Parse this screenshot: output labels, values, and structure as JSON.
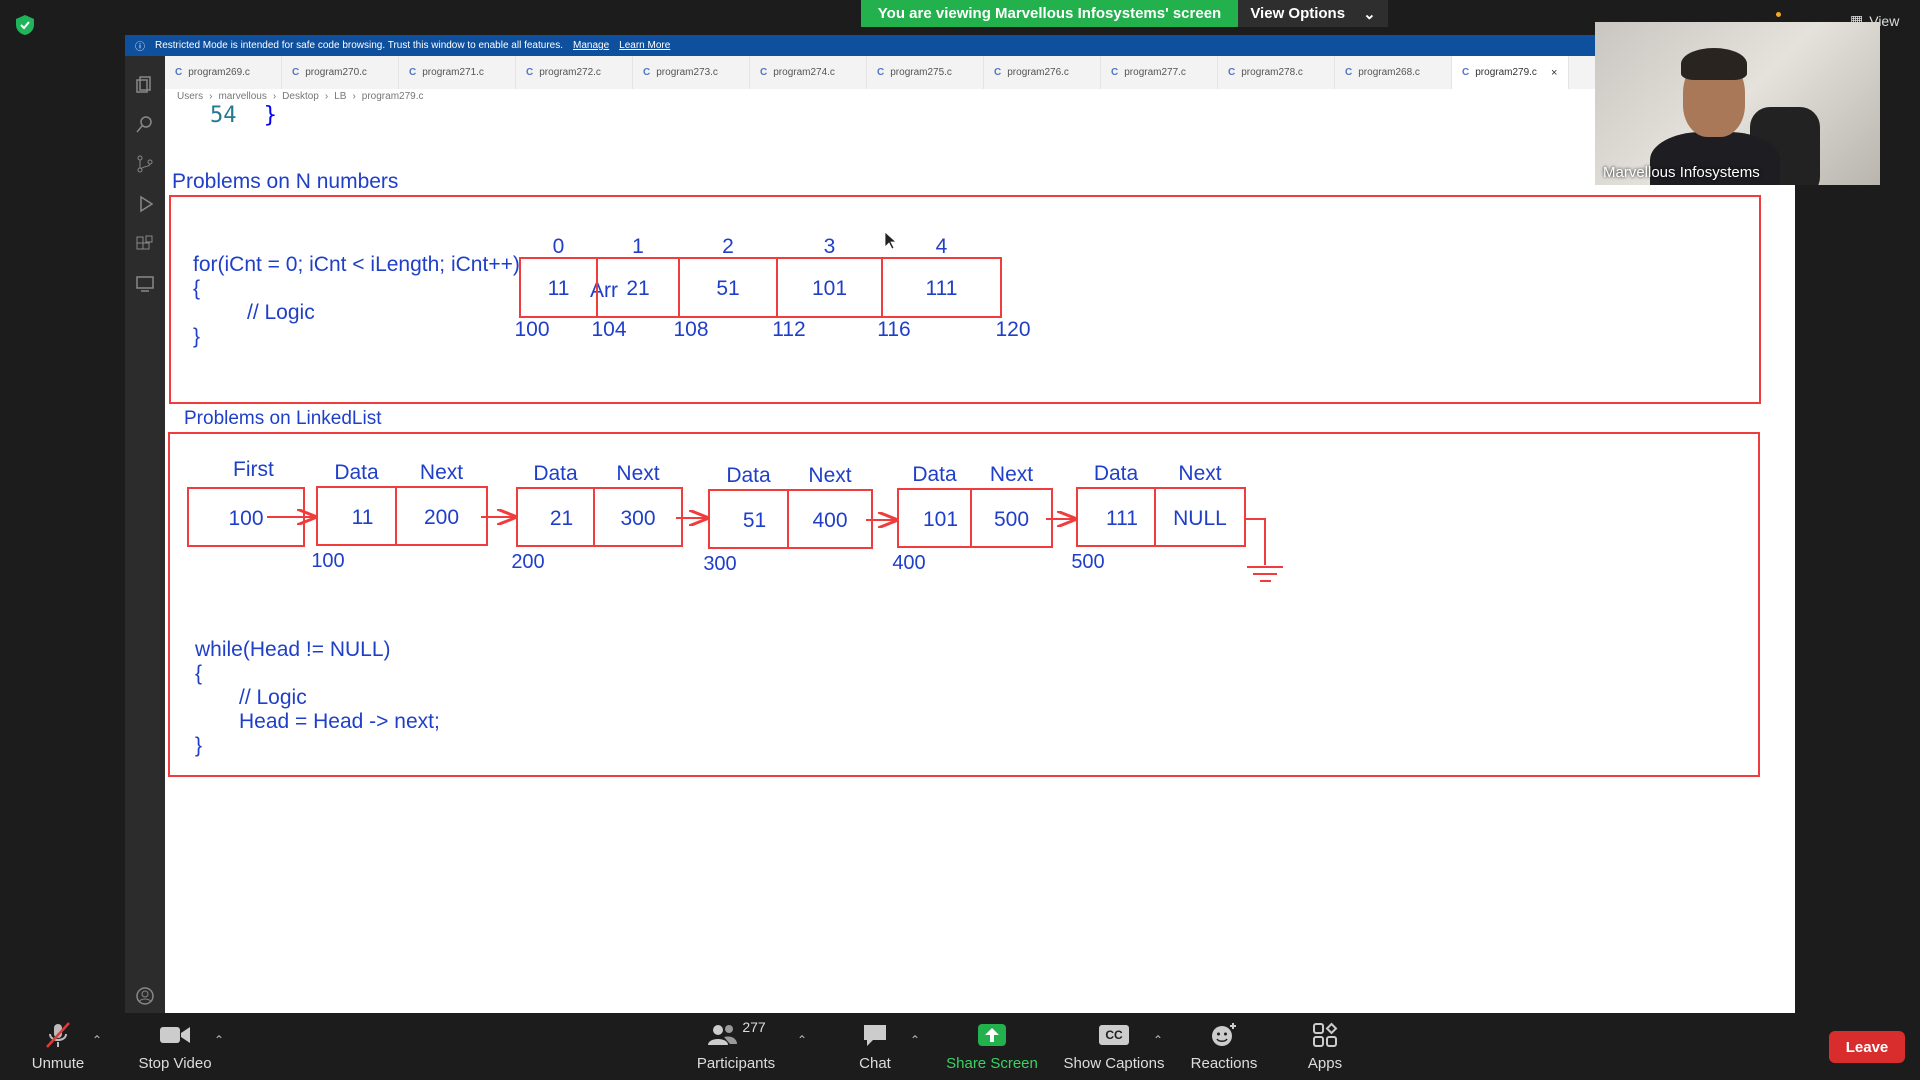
{
  "meeting": {
    "banner_text": "You are viewing Marvellous Infosystems' screen",
    "view_options_label": "View Options",
    "top_view_label": "View"
  },
  "shared_window": {
    "restricted_text": "Restricted Mode is intended for safe code browsing. Trust this window to enable all features.",
    "manage_label": "Manage",
    "learn_more_label": "Learn More",
    "tabs": [
      {
        "label": "program269.c"
      },
      {
        "label": "program270.c"
      },
      {
        "label": "program271.c"
      },
      {
        "label": "program272.c"
      },
      {
        "label": "program273.c"
      },
      {
        "label": "program274.c"
      },
      {
        "label": "program275.c"
      },
      {
        "label": "program276.c"
      },
      {
        "label": "program277.c"
      },
      {
        "label": "program278.c"
      },
      {
        "label": "program268.c"
      },
      {
        "label": "program279.c"
      }
    ],
    "tab_icon_text": "C",
    "breadcrumb": [
      "Users",
      "marvellous",
      "Desktop",
      "LB",
      "program279.c"
    ],
    "code_line_number": "54",
    "code_line_text": "}"
  },
  "whiteboard": {
    "section1_title": "Problems on N numbers",
    "for_code": [
      "for(iCnt = 0; iCnt < iLength; iCnt++)",
      "{",
      "// Logic",
      "}"
    ],
    "array_label": "Arr",
    "array_indices": [
      "0",
      "1",
      "2",
      "3",
      "4"
    ],
    "array_values": [
      "11",
      "21",
      "51",
      "101",
      "111"
    ],
    "array_addresses": [
      "100",
      "104",
      "108",
      "112",
      "116",
      "120"
    ],
    "section2_title": "Problems on LinkedList",
    "first_label": "First",
    "first_value": "100",
    "data_label": "Data",
    "next_label": "Next",
    "nodes": [
      {
        "data": "11",
        "next": "200",
        "address": "100"
      },
      {
        "data": "21",
        "next": "300",
        "address": "200"
      },
      {
        "data": "51",
        "next": "400",
        "address": "300"
      },
      {
        "data": "101",
        "next": "500",
        "address": "400"
      },
      {
        "data": "111",
        "next": "NULL",
        "address": "500"
      }
    ],
    "while_code": [
      "while(Head != NULL)",
      "{",
      "// Logic",
      "Head = Head -> next;",
      "}"
    ]
  },
  "video": {
    "participant_name": "Marvellous Infosystems"
  },
  "toolbar": {
    "unmute_label": "Unmute",
    "stop_video_label": "Stop Video",
    "participants_label": "Participants",
    "participants_count": "277",
    "chat_label": "Chat",
    "share_screen_label": "Share Screen",
    "show_captions_label": "Show Captions",
    "cc_text": "CC",
    "reactions_label": "Reactions",
    "apps_label": "Apps",
    "leave_label": "Leave"
  },
  "colors": {
    "zoom_green": "#23b14d",
    "ink_blue": "#1f3fc8",
    "ink_red": "#f03c3c",
    "leave_red": "#d92d2d"
  }
}
